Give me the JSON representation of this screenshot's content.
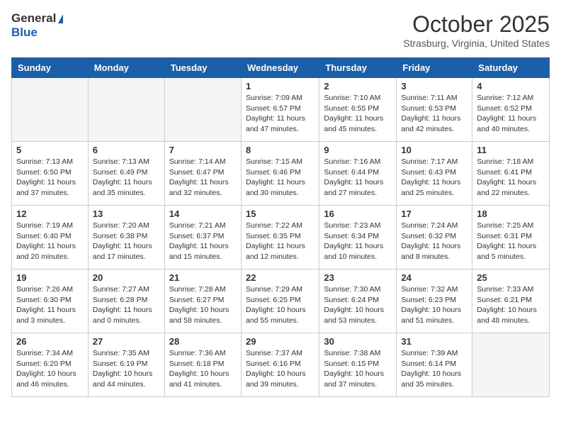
{
  "header": {
    "logo_general": "General",
    "logo_blue": "Blue",
    "month_year": "October 2025",
    "location": "Strasburg, Virginia, United States"
  },
  "weekdays": [
    "Sunday",
    "Monday",
    "Tuesday",
    "Wednesday",
    "Thursday",
    "Friday",
    "Saturday"
  ],
  "weeks": [
    [
      {
        "day": "",
        "info": ""
      },
      {
        "day": "",
        "info": ""
      },
      {
        "day": "",
        "info": ""
      },
      {
        "day": "1",
        "info": "Sunrise: 7:09 AM\nSunset: 6:57 PM\nDaylight: 11 hours and 47 minutes."
      },
      {
        "day": "2",
        "info": "Sunrise: 7:10 AM\nSunset: 6:55 PM\nDaylight: 11 hours and 45 minutes."
      },
      {
        "day": "3",
        "info": "Sunrise: 7:11 AM\nSunset: 6:53 PM\nDaylight: 11 hours and 42 minutes."
      },
      {
        "day": "4",
        "info": "Sunrise: 7:12 AM\nSunset: 6:52 PM\nDaylight: 11 hours and 40 minutes."
      }
    ],
    [
      {
        "day": "5",
        "info": "Sunrise: 7:13 AM\nSunset: 6:50 PM\nDaylight: 11 hours and 37 minutes."
      },
      {
        "day": "6",
        "info": "Sunrise: 7:13 AM\nSunset: 6:49 PM\nDaylight: 11 hours and 35 minutes."
      },
      {
        "day": "7",
        "info": "Sunrise: 7:14 AM\nSunset: 6:47 PM\nDaylight: 11 hours and 32 minutes."
      },
      {
        "day": "8",
        "info": "Sunrise: 7:15 AM\nSunset: 6:46 PM\nDaylight: 11 hours and 30 minutes."
      },
      {
        "day": "9",
        "info": "Sunrise: 7:16 AM\nSunset: 6:44 PM\nDaylight: 11 hours and 27 minutes."
      },
      {
        "day": "10",
        "info": "Sunrise: 7:17 AM\nSunset: 6:43 PM\nDaylight: 11 hours and 25 minutes."
      },
      {
        "day": "11",
        "info": "Sunrise: 7:18 AM\nSunset: 6:41 PM\nDaylight: 11 hours and 22 minutes."
      }
    ],
    [
      {
        "day": "12",
        "info": "Sunrise: 7:19 AM\nSunset: 6:40 PM\nDaylight: 11 hours and 20 minutes."
      },
      {
        "day": "13",
        "info": "Sunrise: 7:20 AM\nSunset: 6:38 PM\nDaylight: 11 hours and 17 minutes."
      },
      {
        "day": "14",
        "info": "Sunrise: 7:21 AM\nSunset: 6:37 PM\nDaylight: 11 hours and 15 minutes."
      },
      {
        "day": "15",
        "info": "Sunrise: 7:22 AM\nSunset: 6:35 PM\nDaylight: 11 hours and 12 minutes."
      },
      {
        "day": "16",
        "info": "Sunrise: 7:23 AM\nSunset: 6:34 PM\nDaylight: 11 hours and 10 minutes."
      },
      {
        "day": "17",
        "info": "Sunrise: 7:24 AM\nSunset: 6:32 PM\nDaylight: 11 hours and 8 minutes."
      },
      {
        "day": "18",
        "info": "Sunrise: 7:25 AM\nSunset: 6:31 PM\nDaylight: 11 hours and 5 minutes."
      }
    ],
    [
      {
        "day": "19",
        "info": "Sunrise: 7:26 AM\nSunset: 6:30 PM\nDaylight: 11 hours and 3 minutes."
      },
      {
        "day": "20",
        "info": "Sunrise: 7:27 AM\nSunset: 6:28 PM\nDaylight: 11 hours and 0 minutes."
      },
      {
        "day": "21",
        "info": "Sunrise: 7:28 AM\nSunset: 6:27 PM\nDaylight: 10 hours and 58 minutes."
      },
      {
        "day": "22",
        "info": "Sunrise: 7:29 AM\nSunset: 6:25 PM\nDaylight: 10 hours and 55 minutes."
      },
      {
        "day": "23",
        "info": "Sunrise: 7:30 AM\nSunset: 6:24 PM\nDaylight: 10 hours and 53 minutes."
      },
      {
        "day": "24",
        "info": "Sunrise: 7:32 AM\nSunset: 6:23 PM\nDaylight: 10 hours and 51 minutes."
      },
      {
        "day": "25",
        "info": "Sunrise: 7:33 AM\nSunset: 6:21 PM\nDaylight: 10 hours and 48 minutes."
      }
    ],
    [
      {
        "day": "26",
        "info": "Sunrise: 7:34 AM\nSunset: 6:20 PM\nDaylight: 10 hours and 46 minutes."
      },
      {
        "day": "27",
        "info": "Sunrise: 7:35 AM\nSunset: 6:19 PM\nDaylight: 10 hours and 44 minutes."
      },
      {
        "day": "28",
        "info": "Sunrise: 7:36 AM\nSunset: 6:18 PM\nDaylight: 10 hours and 41 minutes."
      },
      {
        "day": "29",
        "info": "Sunrise: 7:37 AM\nSunset: 6:16 PM\nDaylight: 10 hours and 39 minutes."
      },
      {
        "day": "30",
        "info": "Sunrise: 7:38 AM\nSunset: 6:15 PM\nDaylight: 10 hours and 37 minutes."
      },
      {
        "day": "31",
        "info": "Sunrise: 7:39 AM\nSunset: 6:14 PM\nDaylight: 10 hours and 35 minutes."
      },
      {
        "day": "",
        "info": ""
      }
    ]
  ]
}
